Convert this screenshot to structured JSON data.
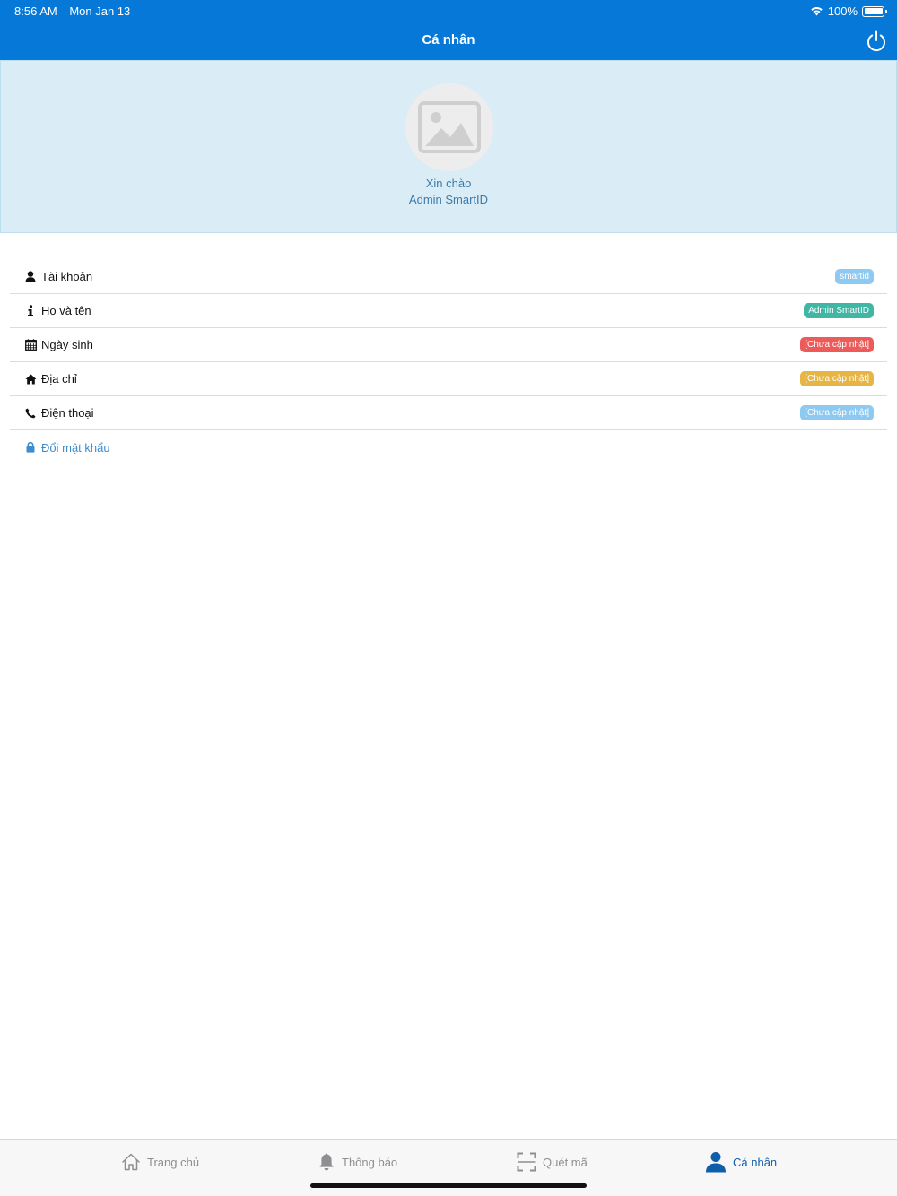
{
  "status": {
    "time": "8:56 AM",
    "date": "Mon Jan 13",
    "battery": "100%"
  },
  "header": {
    "title": "Cá nhân",
    "power_icon": "power-icon"
  },
  "profile": {
    "greeting": "Xin chào",
    "name": "Admin SmartID",
    "avatar_icon": "image-placeholder-icon"
  },
  "info": {
    "rows": [
      {
        "label": "Tài khoản",
        "value": "smartid",
        "icon": "user-icon",
        "color": "#8ec9f1"
      },
      {
        "label": "Họ và tên",
        "value": "Admin SmartID",
        "icon": "info-icon",
        "color": "#3fb7a4"
      },
      {
        "label": "Ngày sinh",
        "value": "[Chưa cập nhật]",
        "icon": "calendar-icon",
        "color": "#ec5a5a"
      },
      {
        "label": "Địa chỉ",
        "value": "[Chưa cập nhật]",
        "icon": "home-icon",
        "color": "#e6b544"
      },
      {
        "label": "Điện thoại",
        "value": "[Chưa cập nhật]",
        "icon": "phone-icon",
        "color": "#8ec9f1"
      }
    ],
    "change_password": {
      "label": "Đổi mật khẩu",
      "icon": "lock-icon",
      "color": "#3c8dd0"
    }
  },
  "tabs": [
    {
      "label": "Trang chủ",
      "icon": "home-outline-icon",
      "active": false
    },
    {
      "label": "Thông báo",
      "icon": "bell-icon",
      "active": false
    },
    {
      "label": "Quét mã",
      "icon": "scan-icon",
      "active": false
    },
    {
      "label": "Cá nhân",
      "icon": "person-icon",
      "active": true
    }
  ],
  "colors": {
    "primary": "#0578d8",
    "banner_bg": "#daedf7",
    "active_tab": "#0f5ea9"
  }
}
